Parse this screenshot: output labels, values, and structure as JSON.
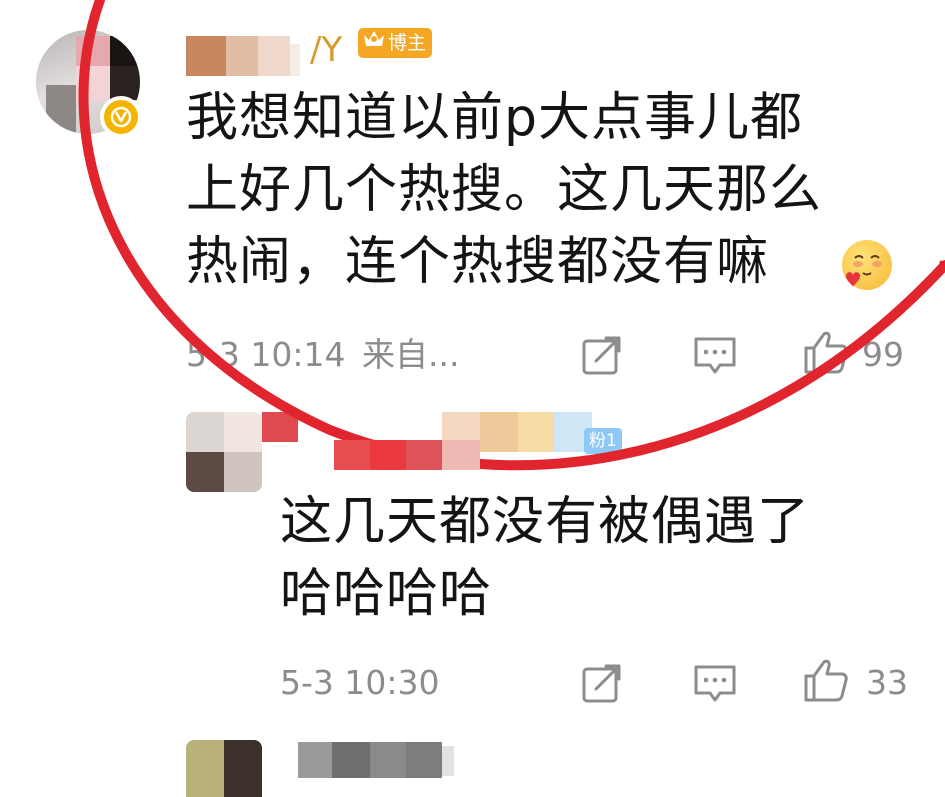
{
  "comments": [
    {
      "username_suffix": "/Y",
      "badge_label": "博主",
      "text_lines": [
        "我想知道以前p大点事儿都",
        "上好几个热搜。这几天那么",
        "热闹，连个热搜都没有嘛"
      ],
      "timestamp": "5-3 10:14",
      "source": "来自...",
      "like_count": "99"
    },
    {
      "fans_badge_label": "粉1",
      "text_lines": [
        "这几天都没有被偶遇了",
        "哈哈哈哈"
      ],
      "timestamp": "5-3 10:30",
      "like_count": "33"
    }
  ],
  "icons": {
    "share": "share-icon",
    "comment": "comment-icon",
    "like": "thumbs-up-icon",
    "verified": "verified-v-icon",
    "crown": "crown-icon",
    "emoji": "blush-emoji-icon"
  },
  "colors": {
    "annotation_red": "#e0252f",
    "badge_orange": "#f5a623",
    "fans_badge_blue": "#8ec9f5",
    "meta_gray": "#8c8c8c",
    "text_dark": "#141414"
  }
}
